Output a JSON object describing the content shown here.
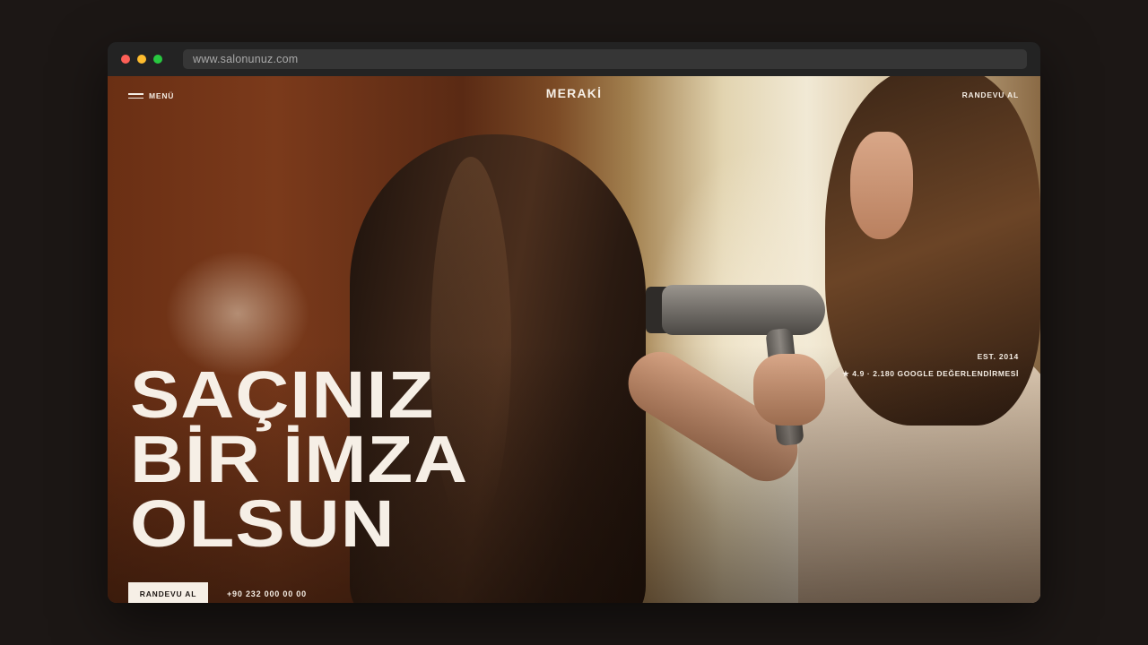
{
  "browser": {
    "url": "www.salonunuz.com"
  },
  "nav": {
    "menu_label": "MENÜ",
    "logo": "MERAKİ",
    "cta_label": "RANDEVU AL"
  },
  "hero": {
    "headline": [
      "SAÇINIZ",
      "BİR İMZA",
      "OLSUN"
    ],
    "established": "EST. 2014",
    "rating_text": "★ 4.9 · 2.180 GOOGLE DEĞERLENDİRMESİ",
    "cta_label": "RANDEVU AL",
    "phone": "+90 232 000 00 00"
  },
  "colors": {
    "text_light": "#f6efe6",
    "page_background": "#1c1715",
    "browser_chrome": "#232323"
  }
}
